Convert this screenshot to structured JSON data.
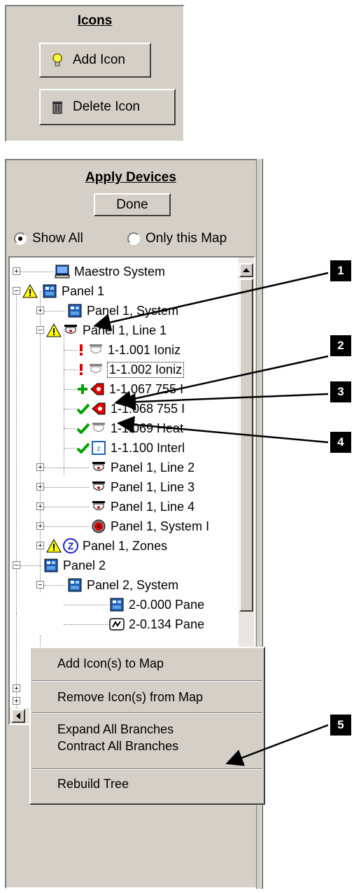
{
  "icons_panel": {
    "heading": "Icons",
    "add_icon_label": "Add Icon",
    "delete_icon_label": "Delete Icon"
  },
  "apply_panel": {
    "heading": "Apply Devices",
    "done_label": "Done",
    "show_all_label": "Show All",
    "only_map_label": "Only this Map",
    "selected_radio": "Show All"
  },
  "tree": {
    "rows": [
      {
        "label": "Maestro System",
        "icon": "computer-icon"
      },
      {
        "label": "Panel 1",
        "icon": "panel-icon",
        "warning": true
      },
      {
        "label": "Panel 1, System",
        "icon": "panel-icon"
      },
      {
        "label": "Panel 1, Line 1",
        "icon": "detector-icon",
        "warning": true
      },
      {
        "label": "1-1.001 Ioniz",
        "icon": "detector-icon",
        "status": "exclamation-icon"
      },
      {
        "label": "1-1.002 Ioniz",
        "icon": "detector-icon",
        "status": "exclamation-icon"
      },
      {
        "label": "1-1.067 755 I",
        "icon": "red-module-icon",
        "status": "plus-icon"
      },
      {
        "label": "1-1.068 755 I",
        "icon": "red-module-icon",
        "status": "check-icon"
      },
      {
        "label": "1-1.069 Heat",
        "icon": "detector-icon",
        "status": "check-icon"
      },
      {
        "label": "1-1.100 Interl",
        "icon": "interface-icon",
        "status": "check-icon"
      },
      {
        "label": "Panel 1, Line 2",
        "icon": "detector-icon"
      },
      {
        "label": "Panel 1, Line 3",
        "icon": "detector-icon"
      },
      {
        "label": "Panel 1, Line 4",
        "icon": "detector-icon"
      },
      {
        "label": "Panel 1, System I",
        "icon": "bell-icon"
      },
      {
        "label": "Panel 1, Zones",
        "icon": "zone-icon",
        "warning": true
      },
      {
        "label": "Panel 2",
        "icon": "panel-icon"
      },
      {
        "label": "Panel 2, System",
        "icon": "panel-icon"
      },
      {
        "label": "2-0.000 Pane",
        "icon": "panel-icon"
      },
      {
        "label": "2-0.134 Pane",
        "icon": "relay-icon"
      }
    ]
  },
  "context_menu": {
    "items": [
      "Add Icon(s) to Map",
      "Remove Icon(s) from Map",
      "Expand All Branches",
      "Contract All Branches",
      "Rebuild Tree"
    ]
  },
  "callouts": [
    "1",
    "2",
    "3",
    "4",
    "5"
  ],
  "colors": {
    "face": "#d4d0c8",
    "warning": "#ffff00",
    "check": "#00a000",
    "exclaim": "#e00000",
    "panel_blue": "#1c5fb8"
  }
}
